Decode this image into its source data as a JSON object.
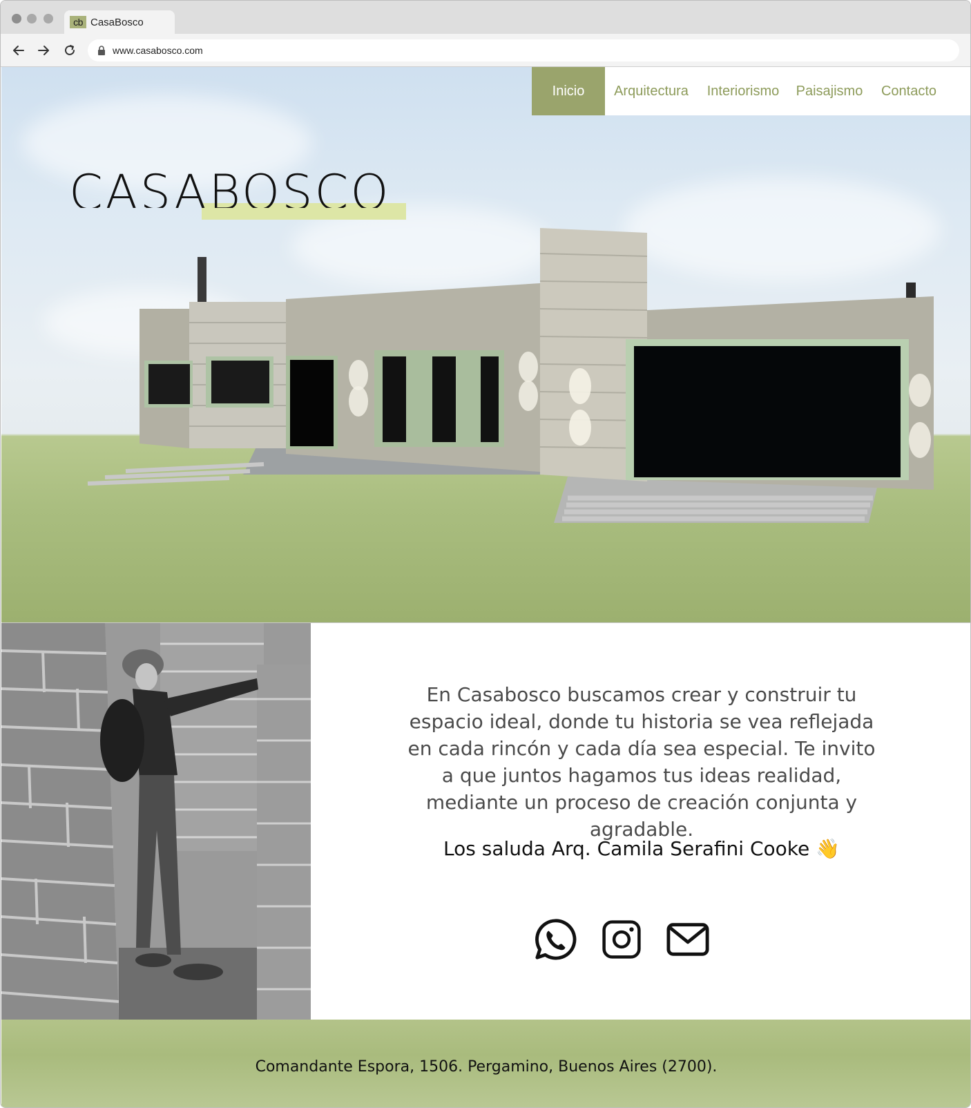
{
  "browser": {
    "tab_title": "CasaBosco",
    "favicon_text": "cb",
    "url": "www.casabosco.com"
  },
  "nav": {
    "items": [
      {
        "label": "Inicio",
        "active": true
      },
      {
        "label": "Arquitectura",
        "active": false
      },
      {
        "label": "Interiorismo",
        "active": false
      },
      {
        "label": "Paisajismo",
        "active": false
      },
      {
        "label": "Contacto",
        "active": false
      }
    ]
  },
  "hero": {
    "logo_text": "CASABOSCO",
    "image": "house-render"
  },
  "intro": {
    "text": "En Casabosco buscamos crear y construir tu espacio ideal, donde tu historia se vea reflejada en cada rincón y cada día sea especial.  Te invito a que juntos hagamos tus ideas realidad, mediante un proceso de creación conjunta y agradable.",
    "greeting": "Los saluda Arq. Camila Serafini Cooke 👋",
    "photo": "architect-photo"
  },
  "socials": [
    {
      "icon": "whatsapp-icon"
    },
    {
      "icon": "instagram-icon"
    },
    {
      "icon": "email-icon"
    }
  ],
  "footer": {
    "address": "Comandante  Espora, 1506.  Pergamino,  Buenos Aires (2700)."
  },
  "colors": {
    "accent": "#9aa46c",
    "nav_text": "#8d9b5a",
    "logo_bar": "#dde6a6"
  }
}
